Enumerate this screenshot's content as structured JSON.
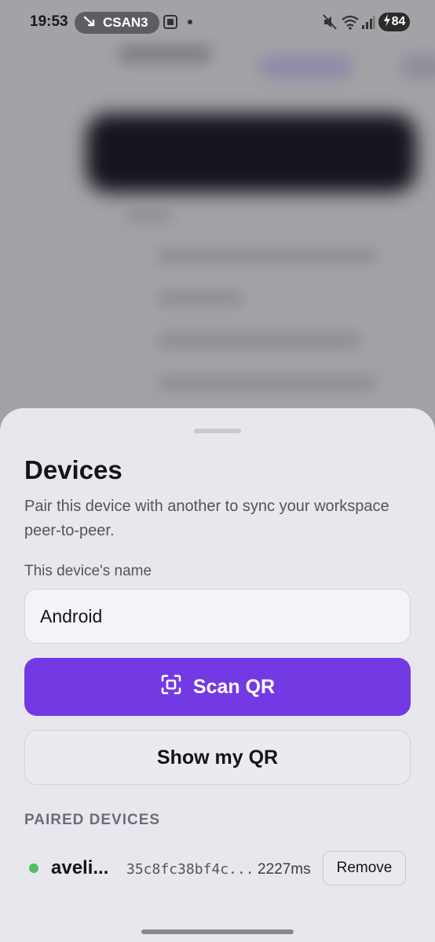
{
  "status_bar": {
    "time": "19:53",
    "carrier": "CSAN3",
    "carrier_icon": "trend-down-icon",
    "battery": "84",
    "icons": [
      "screenshot-icon",
      "mute-icon",
      "wifi-icon",
      "signal-icon",
      "charging-icon"
    ]
  },
  "sheet": {
    "title": "Devices",
    "description": "Pair this device with another to sync your workspace peer-to-peer.",
    "name_label": "This device's name",
    "name_value": "Android",
    "scan_label": "Scan QR",
    "show_label": "Show my QR",
    "paired_header": "PAIRED DEVICES",
    "paired": [
      {
        "name": "aveli...",
        "id": "35c8fc38bf4c...",
        "latency": "2227ms",
        "status": "online",
        "remove_label": "Remove"
      }
    ]
  },
  "colors": {
    "accent": "#733ae4",
    "online": "#4bbf63",
    "sheet_bg": "#e9e7ee"
  }
}
